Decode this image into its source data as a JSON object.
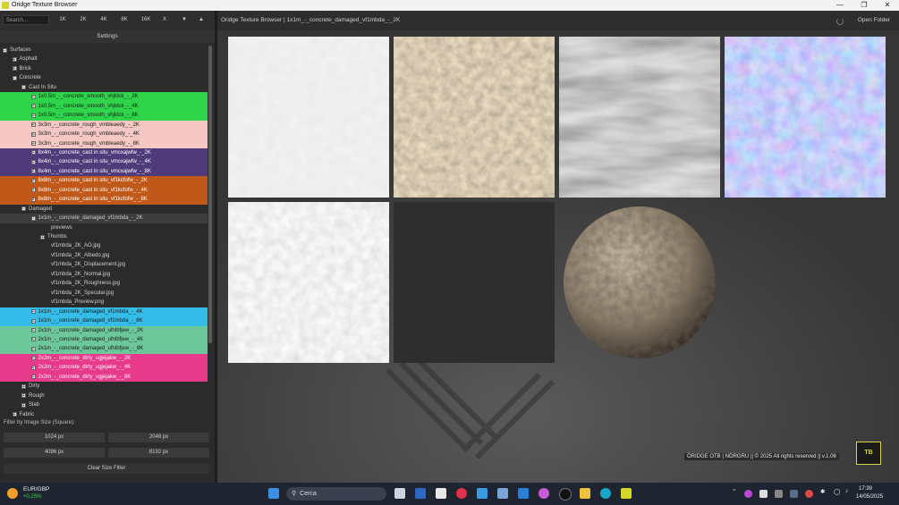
{
  "window": {
    "title": "Oridge Texture Browser",
    "controls": [
      "minimize",
      "maximize",
      "close"
    ]
  },
  "toolbar": {
    "search_placeholder": "Search...",
    "resolutions": [
      "1K",
      "2K",
      "4K",
      "8K",
      "16K",
      "X"
    ],
    "sort_down": "▼",
    "sort_up": "▲"
  },
  "settings_label": "Settings",
  "tree": [
    {
      "label": "Surfaces",
      "depth": 0,
      "box": "−",
      "color": ""
    },
    {
      "label": "Asphalt",
      "depth": 1,
      "box": "+",
      "color": ""
    },
    {
      "label": "Brick",
      "depth": 1,
      "box": "+",
      "color": ""
    },
    {
      "label": "Concrete",
      "depth": 1,
      "box": "−",
      "color": ""
    },
    {
      "label": "Cast In Situ",
      "depth": 2,
      "box": "−",
      "color": ""
    },
    {
      "label": "1x0.5m_-_concrete_smooth_vhjldck_-_2K",
      "depth": 3,
      "box": "+",
      "color": "#2fd44a"
    },
    {
      "label": "1x0.5m_-_concrete_smooth_vhjldck_-_4K",
      "depth": 3,
      "box": "+",
      "color": "#2fd44a"
    },
    {
      "label": "1x0.5m_-_concrete_smooth_vhjldck_-_8K",
      "depth": 3,
      "box": "+",
      "color": "#2fd44a"
    },
    {
      "label": "3x3m_-_concrete_rough_vmbleaedy_-_2K",
      "depth": 3,
      "box": "+",
      "color": "#f6c8c3"
    },
    {
      "label": "3x3m_-_concrete_rough_vmbleaedy_-_4K",
      "depth": 3,
      "box": "+",
      "color": "#f6c8c3"
    },
    {
      "label": "3x3m_-_concrete_rough_vmbleaedy_-_8K",
      "depth": 3,
      "box": "+",
      "color": "#f6c8c3"
    },
    {
      "label": "8x4m_-_concrete_cast in situ_vmcxajwfw_-_2K",
      "depth": 3,
      "box": "+",
      "color": "#4f3a7a"
    },
    {
      "label": "8x4m_-_concrete_cast in situ_vmcxajwfw_-_4K",
      "depth": 3,
      "box": "+",
      "color": "#4f3a7a"
    },
    {
      "label": "8x4m_-_concrete_cast in situ_vmcxajwfw_-_8K",
      "depth": 3,
      "box": "+",
      "color": "#4f3a7a"
    },
    {
      "label": "8x8m_-_concrete_cast in situ_vf1kcfofw_-_2K",
      "depth": 3,
      "box": "+",
      "color": "#c0581a"
    },
    {
      "label": "8x8m_-_concrete_cast in situ_vf1kcfofw_-_4K",
      "depth": 3,
      "box": "+",
      "color": "#c0581a"
    },
    {
      "label": "8x8m_-_concrete_cast in situ_vf1kcfofw_-_8K",
      "depth": 3,
      "box": "+",
      "color": "#c0581a"
    },
    {
      "label": "Damaged",
      "depth": 2,
      "box": "−",
      "color": ""
    },
    {
      "label": "1x1m_-_concrete_damaged_vf1mbda_-_2K",
      "depth": 3,
      "box": "−",
      "color": "#3d3d3d"
    },
    {
      "label": "previews",
      "depth": 4,
      "box": "",
      "color": ""
    },
    {
      "label": "Thumbs",
      "depth": 4,
      "box": "+",
      "color": ""
    },
    {
      "label": "vf1mbda_2K_AO.jpg",
      "depth": 4,
      "box": "",
      "color": ""
    },
    {
      "label": "vf1mbda_2K_Albedo.jpg",
      "depth": 4,
      "box": "",
      "color": ""
    },
    {
      "label": "vf1mbda_2K_Displacement.jpg",
      "depth": 4,
      "box": "",
      "color": ""
    },
    {
      "label": "vf1mbda_2K_Normal.jpg",
      "depth": 4,
      "box": "",
      "color": ""
    },
    {
      "label": "vf1mbda_2K_Roughness.jpg",
      "depth": 4,
      "box": "",
      "color": ""
    },
    {
      "label": "vf1mbda_2K_Specular.jpg",
      "depth": 4,
      "box": "",
      "color": ""
    },
    {
      "label": "vf1mbda_Preview.png",
      "depth": 4,
      "box": "",
      "color": ""
    },
    {
      "label": "1x1m_-_concrete_damaged_vf1mbda_-_4K",
      "depth": 3,
      "box": "+",
      "color": "#33bde8"
    },
    {
      "label": "1x1m_-_concrete_damaged_vf1mbda_-_8K",
      "depth": 3,
      "box": "+",
      "color": "#33bde8"
    },
    {
      "label": "2x1m_-_concrete_damaged_ufnlbfjew_-_2K",
      "depth": 3,
      "box": "+",
      "color": "#6cc79a"
    },
    {
      "label": "2x1m_-_concrete_damaged_ufnlbfjew_-_4K",
      "depth": 3,
      "box": "+",
      "color": "#6cc79a"
    },
    {
      "label": "2x1m_-_concrete_damaged_ufnlbfjew_-_8K",
      "depth": 3,
      "box": "+",
      "color": "#6cc79a"
    },
    {
      "label": "2x2m_-_concrete_dirty_ugjejakw_-_2K",
      "depth": 3,
      "box": "+",
      "color": "#e83a8a"
    },
    {
      "label": "2x2m_-_concrete_dirty_ugjejakw_-_4K",
      "depth": 3,
      "box": "+",
      "color": "#e83a8a"
    },
    {
      "label": "2x2m_-_concrete_dirty_ugjejakw_-_8K",
      "depth": 3,
      "box": "+",
      "color": "#e83a8a"
    },
    {
      "label": "Dirty",
      "depth": 2,
      "box": "+",
      "color": ""
    },
    {
      "label": "Rough",
      "depth": 2,
      "box": "+",
      "color": ""
    },
    {
      "label": "Slab",
      "depth": 2,
      "box": "+",
      "color": ""
    },
    {
      "label": "Fabric",
      "depth": 1,
      "box": "+",
      "color": ""
    }
  ],
  "filter": {
    "label": "Filter by Image Size (Square):",
    "sizes": [
      "1024 px",
      "2048 px",
      "4096 px",
      "8192 px"
    ],
    "clear_label": "Clear Size Filter"
  },
  "main": {
    "path": "Oridge Texture Browser | 1x1m_-_concrete_damaged_vf1mbda_-_2K",
    "open_folder": "Open Folder",
    "footer": "ÖRIDGE OTB  |  NÖRGRU  ||  © 2025  All rights reserved  ||  v.1.06",
    "logo": "TB"
  },
  "taskbar": {
    "weather_label": "EUR/GBP",
    "weather_value": "+0,25%",
    "search_label": "Cerca",
    "time": "17:39",
    "date": "14/05/2025",
    "accent_colors": {
      "green": "#3ad24a",
      "blue": "#33bde8",
      "pink": "#e83a8a",
      "orange": "#c0581a",
      "purple": "#4f3a7a"
    }
  }
}
